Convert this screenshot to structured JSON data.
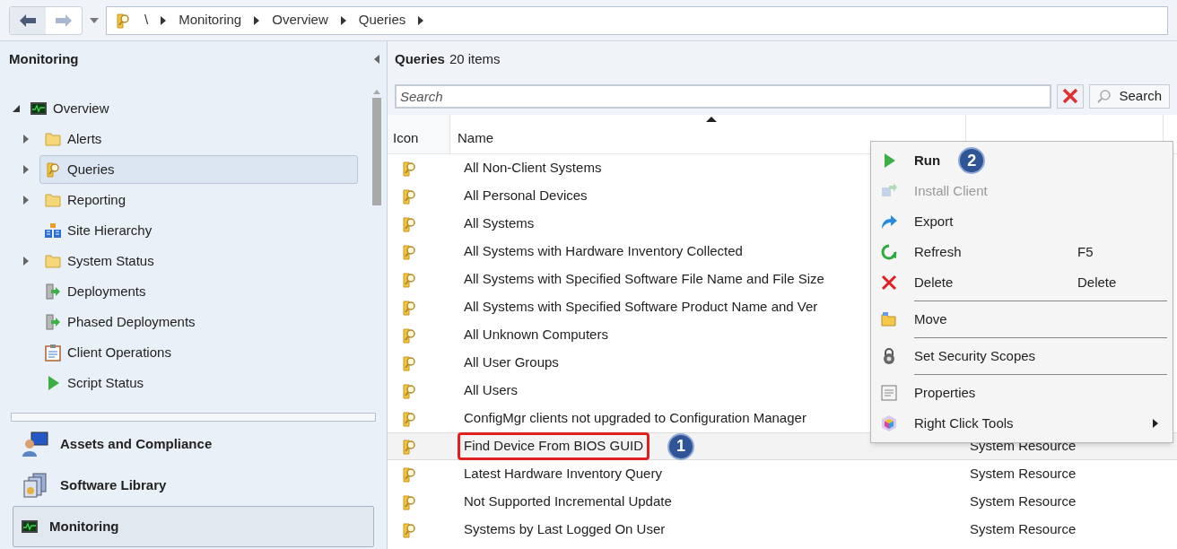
{
  "toolbar": {
    "breadcrumb": [
      "\\",
      "Monitoring",
      "Overview",
      "Queries"
    ]
  },
  "nav": {
    "title": "Monitoring",
    "tree": [
      {
        "label": "Overview",
        "kind": "monitor",
        "expanded": true,
        "selected": false,
        "children": [
          {
            "label": "Alerts",
            "kind": "folder",
            "expandable": true,
            "selected": false
          },
          {
            "label": "Queries",
            "kind": "query",
            "expandable": true,
            "selected": true
          },
          {
            "label": "Reporting",
            "kind": "folder",
            "expandable": true,
            "selected": false
          },
          {
            "label": "Site Hierarchy",
            "kind": "hierarchy",
            "expandable": false,
            "selected": false
          },
          {
            "label": "System Status",
            "kind": "folder",
            "expandable": true,
            "selected": false
          },
          {
            "label": "Deployments",
            "kind": "deploy",
            "expandable": false,
            "selected": false
          },
          {
            "label": "Phased Deployments",
            "kind": "deploy",
            "expandable": false,
            "selected": false
          },
          {
            "label": "Client Operations",
            "kind": "clipboard",
            "expandable": false,
            "selected": false
          },
          {
            "label": "Script Status",
            "kind": "play",
            "expandable": false,
            "selected": false
          }
        ]
      }
    ],
    "workspaces": [
      {
        "label": "Assets and Compliance",
        "kind": "assets",
        "selected": false
      },
      {
        "label": "Software Library",
        "kind": "library",
        "selected": false
      },
      {
        "label": "Monitoring",
        "kind": "monitor",
        "selected": true
      }
    ]
  },
  "list": {
    "title": "Queries",
    "count": "20 items",
    "search": {
      "placeholder": "Search",
      "button": "Search"
    },
    "columns": [
      "Icon",
      "Name"
    ],
    "rows": [
      {
        "name": "All Non-Client Systems",
        "selected": false,
        "outlined": false
      },
      {
        "name": "All Personal Devices",
        "selected": false,
        "outlined": false
      },
      {
        "name": "All Systems",
        "selected": false,
        "outlined": false
      },
      {
        "name": "All Systems with Hardware Inventory Collected",
        "selected": false,
        "outlined": false
      },
      {
        "name": "All Systems with Specified Software File Name and File Size",
        "selected": false,
        "outlined": false
      },
      {
        "name": "All Systems with Specified Software Product Name and Ver",
        "selected": false,
        "outlined": false
      },
      {
        "name": "All Unknown Computers",
        "selected": false,
        "outlined": false
      },
      {
        "name": "All User Groups",
        "selected": false,
        "outlined": false
      },
      {
        "name": "All Users",
        "selected": false,
        "outlined": false
      },
      {
        "name": "ConfigMgr clients not upgraded to Configuration Manager",
        "selected": false,
        "outlined": false
      },
      {
        "name": "Find Device From BIOS GUID",
        "resource_class": "System Resource",
        "selected": true,
        "outlined": true,
        "callout": "1"
      },
      {
        "name": "Latest Hardware Inventory Query",
        "resource_class": "System Resource",
        "selected": false,
        "outlined": false
      },
      {
        "name": "Not Supported Incremental Update",
        "resource_class": "System Resource",
        "selected": false,
        "outlined": false
      },
      {
        "name": "Systems by Last Logged On User",
        "resource_class": "System Resource",
        "selected": false,
        "outlined": false
      }
    ]
  },
  "context_menu": [
    {
      "kind": "run",
      "label": "Run",
      "default": true,
      "disabled": false,
      "callout": "2"
    },
    {
      "kind": "install",
      "label": "Install Client",
      "default": false,
      "disabled": true
    },
    {
      "kind": "export",
      "label": "Export",
      "default": false,
      "disabled": false
    },
    {
      "kind": "refresh",
      "label": "Refresh",
      "shortcut": "F5",
      "default": false,
      "disabled": false
    },
    {
      "kind": "delete",
      "label": "Delete",
      "shortcut": "Delete",
      "default": false,
      "disabled": false
    },
    {
      "kind": "separator"
    },
    {
      "kind": "move",
      "label": "Move",
      "default": false,
      "disabled": false
    },
    {
      "kind": "separator"
    },
    {
      "kind": "lock",
      "label": "Set Security Scopes",
      "default": false,
      "disabled": false
    },
    {
      "kind": "separator"
    },
    {
      "kind": "properties",
      "label": "Properties",
      "default": false,
      "disabled": false
    },
    {
      "kind": "tools",
      "label": "Right Click Tools",
      "submenu": true,
      "default": false,
      "disabled": false
    }
  ]
}
